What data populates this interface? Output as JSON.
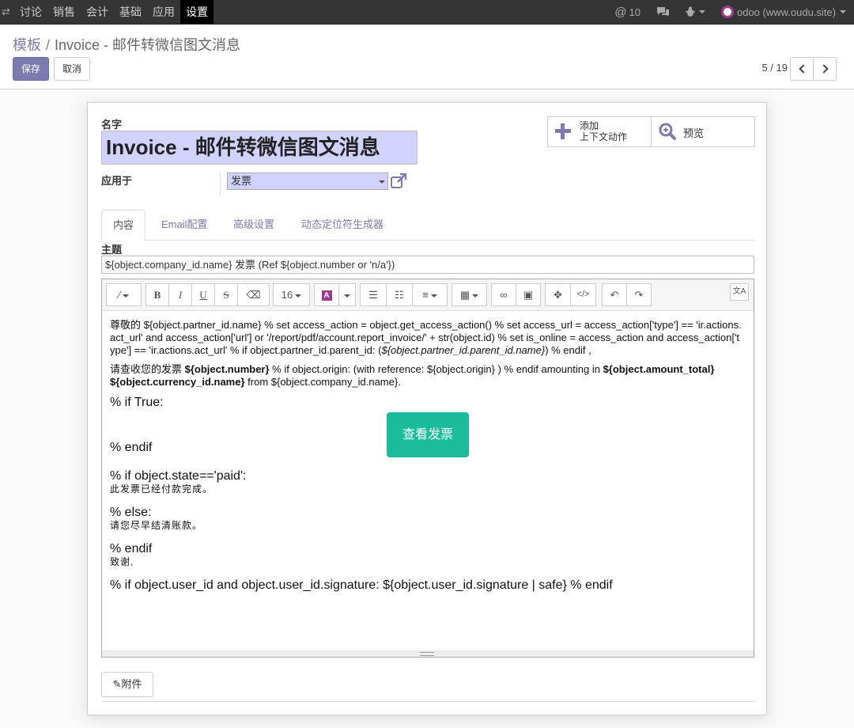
{
  "navbar": {
    "menu": [
      "讨论",
      "销售",
      "会计",
      "基础",
      "应用",
      "设置"
    ],
    "active_index": 5,
    "notifications_count": "10",
    "user_label": "odoo (www.oudu.site)"
  },
  "breadcrumb": {
    "parent": "模板",
    "current": "Invoice - 邮件转微信图文消息"
  },
  "buttons": {
    "save": "保存",
    "cancel": "取消"
  },
  "pager": {
    "value": "5 / 19"
  },
  "form": {
    "name_label": "名字",
    "name_value": "Invoice - 邮件转微信图文消息",
    "apply_label": "应用于",
    "apply_value": "发票",
    "action_add_line1": "添加",
    "action_add_line2": "上下文动作",
    "action_preview": "预览"
  },
  "tabs": [
    "内容",
    "Email配置",
    "高级设置",
    "动态定位符生成器"
  ],
  "subject": {
    "label": "主题",
    "value": "${object.company_id.name} 发票 (Ref ${object.number or 'n/a'})"
  },
  "toolbar": {
    "font_size": "16"
  },
  "body": {
    "p1": "尊敬的 ${object.partner_id.name} % set access_action = object.get_access_action() % set access_url = access_action['type'] == 'ir.actions.act_url' and access_action['url'] or '/report/pdf/account.report_invoice/' + str(object.id) % set is_online = access_action and access_action['type'] == 'ir.actions.act_url' % if object.partner_id.parent_id: (",
    "p1_italic": "${object.partner_id.parent_id.name}",
    "p1_end": ") % endif ,",
    "p2_a": "请查收您的发票 ",
    "p2_b": "${object.number}",
    "p2_c": " % if object.origin: (with reference: ${object.origin} ) % endif amounting in ",
    "p2_d": "${object.amount_total} ${object.currency_id.name}",
    "p2_e": " from ${object.company_id.name}.",
    "if_true": "% if True:",
    "view_button": "查看发票",
    "endif1": "% endif",
    "if_paid": "% if object.state=='paid':",
    "paid_text": "此发票已经付款完成。",
    "else": "% else:",
    "unpaid_text": "请您尽早结清账款。",
    "endif2": "% endif",
    "thanks": "致谢,",
    "signature": "% if object.user_id and object.user_id.signature: ${object.user_id.signature | safe} % endif"
  },
  "attachments_label": "附件",
  "colors": {
    "brand": "#7c7bad",
    "required_field": "#d2d2ff",
    "view_button": "#1bbc9b",
    "navbar": "#353535"
  }
}
